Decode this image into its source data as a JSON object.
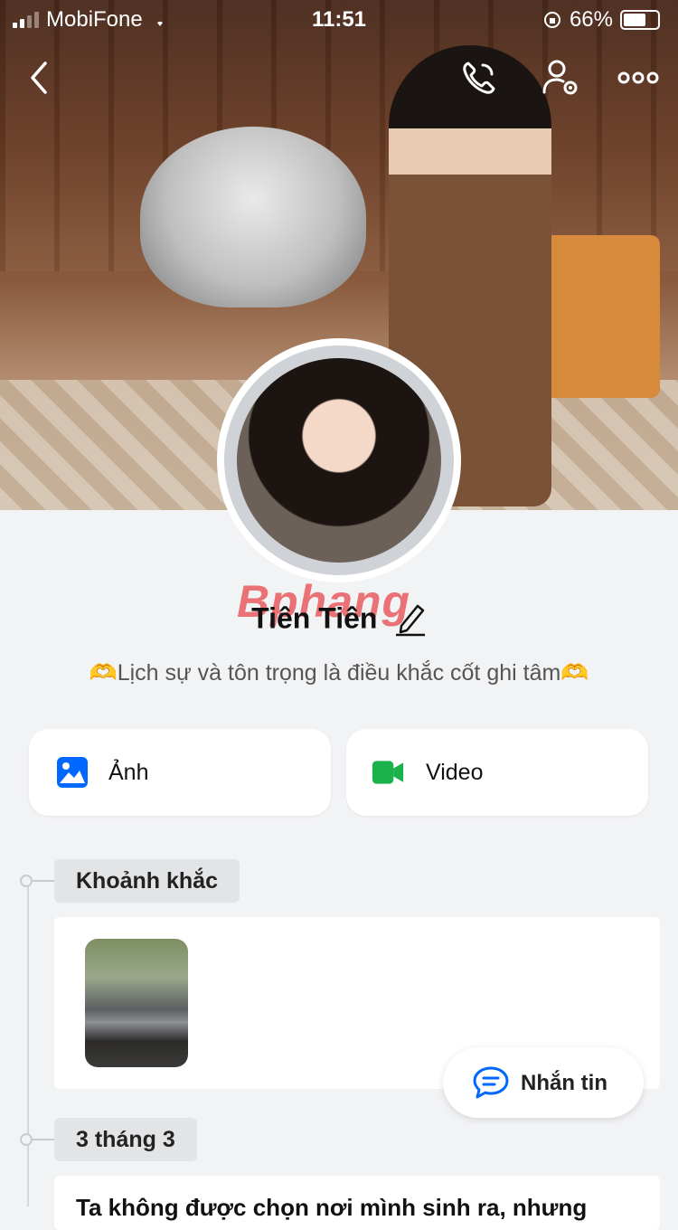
{
  "status_bar": {
    "carrier": "MobiFone",
    "time": "11:51",
    "battery": "66%"
  },
  "profile": {
    "name": "Tiên Tiên",
    "bio": "🫶Lịch sự và tôn trọng là điều khắc cốt ghi tâm🫶",
    "watermark": "Bphang"
  },
  "actions": {
    "photos_label": "Ảnh",
    "video_label": "Video"
  },
  "timeline": [
    {
      "tag": "Khoảnh khắc"
    },
    {
      "tag": "3 tháng 3",
      "post_text": "Ta không được chọn nơi mình sinh ra, nhưng"
    }
  ],
  "message_button": {
    "label": "Nhắn tin"
  },
  "colors": {
    "accent_blue": "#0068ff",
    "video_green": "#19b24b",
    "background": "#f2f3f5"
  },
  "icons": [
    "back-chevron-icon",
    "phone-icon",
    "user-settings-icon",
    "more-icon",
    "edit-pencil-icon",
    "image-icon",
    "video-camera-icon",
    "chat-bubble-icon"
  ]
}
